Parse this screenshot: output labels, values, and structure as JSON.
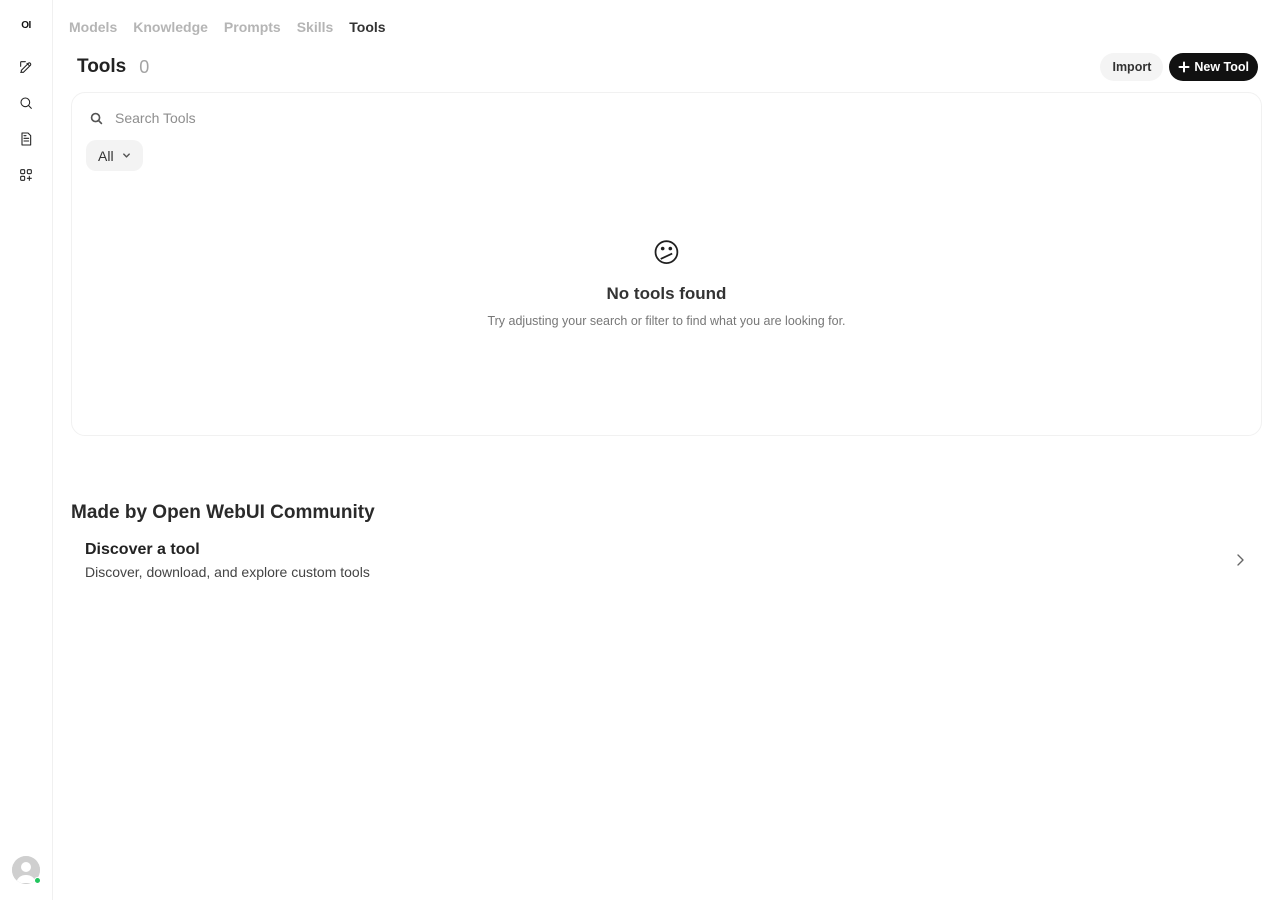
{
  "app": {
    "logo_text": "OI"
  },
  "sidebar": {
    "items": [
      {
        "name": "new-chat",
        "icon": "pencil-square-icon"
      },
      {
        "name": "search",
        "icon": "search-icon"
      },
      {
        "name": "notes",
        "icon": "document-icon"
      },
      {
        "name": "workspace",
        "icon": "grid-plus-icon"
      }
    ],
    "user_status": "online",
    "status_color": "#22c55e"
  },
  "nav": {
    "tabs": [
      {
        "label": "Models",
        "active": false
      },
      {
        "label": "Knowledge",
        "active": false
      },
      {
        "label": "Prompts",
        "active": false
      },
      {
        "label": "Skills",
        "active": false
      },
      {
        "label": "Tools",
        "active": true
      }
    ]
  },
  "header": {
    "title": "Tools",
    "count": "0",
    "import_label": "Import",
    "new_label": "New Tool"
  },
  "search": {
    "placeholder": "Search Tools",
    "value": ""
  },
  "filter": {
    "selected": "All"
  },
  "empty_state": {
    "emoji": "😕",
    "title": "No tools found",
    "subtitle": "Try adjusting your search or filter to find what you are looking for."
  },
  "community": {
    "heading": "Made by Open WebUI Community",
    "discover_title": "Discover a tool",
    "discover_subtitle": "Discover, download, and explore custom tools"
  },
  "colors": {
    "primary_button": "#111111",
    "muted_tab": "#b5b5b5",
    "active_tab": "#333333"
  }
}
